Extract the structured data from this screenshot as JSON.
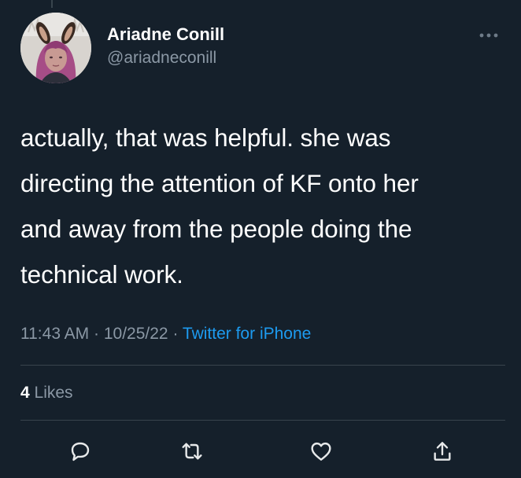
{
  "tweet": {
    "author": {
      "display_name": "Ariadne Conill",
      "handle": "@ariadneconill",
      "avatar_icon": "avatar"
    },
    "text": "actually, that was helpful.  she was\ndirecting the attention of KF onto her\nand away from the people doing the\ntechnical work.",
    "time": "11:43 AM",
    "separator": "·",
    "date": "10/25/22",
    "source": "Twitter for iPhone",
    "likes": {
      "count": "4",
      "label": "Likes"
    }
  },
  "actions": [
    {
      "name": "reply",
      "icon": "reply-icon"
    },
    {
      "name": "retweet",
      "icon": "retweet-icon"
    },
    {
      "name": "like",
      "icon": "heart-icon"
    },
    {
      "name": "share",
      "icon": "share-icon"
    }
  ],
  "colors": {
    "background": "#15202b",
    "primary_text": "#ffffff",
    "secondary_text": "#8b98a5",
    "link": "#1d9bf0",
    "divider": "#38444d"
  }
}
